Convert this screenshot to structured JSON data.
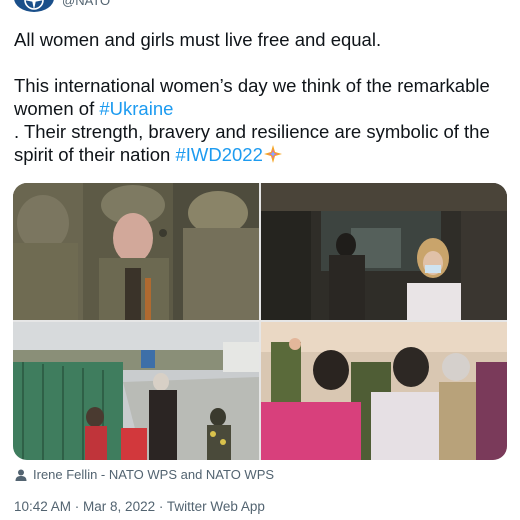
{
  "account": {
    "handle": "@NATO",
    "avatar_icon": "nato-compass-logo"
  },
  "tweet": {
    "line1": "All women and girls must live free and equal.",
    "para2_start": "This international women’s day we think of the remarkable women of ",
    "hashtag_ukraine": "#Ukraine",
    "flag_icon": "ukraine-flag-emoji",
    "para2_middle": ". Their strength, bravery and resilience are symbolic of the spirit of their nation ",
    "hashtag_iwd": "#IWD2022",
    "sparkle_icon": "iwd-sparkle-emoji"
  },
  "media": {
    "photos": [
      {
        "name": "female-soldier-photo"
      },
      {
        "name": "corridor-medical-worker-photo"
      },
      {
        "name": "border-crossing-photo"
      },
      {
        "name": "camouflage-net-weaving-photo"
      }
    ],
    "credit": "Irene Fellin - NATO WPS and NATO WPS"
  },
  "meta": {
    "time": "10:42 AM",
    "separator1": " · ",
    "date": "Mar 8, 2022",
    "separator2": " · ",
    "source": "Twitter Web App"
  },
  "colors": {
    "link": "#1d9bf0",
    "text": "#0f1419",
    "secondary": "#536471"
  }
}
